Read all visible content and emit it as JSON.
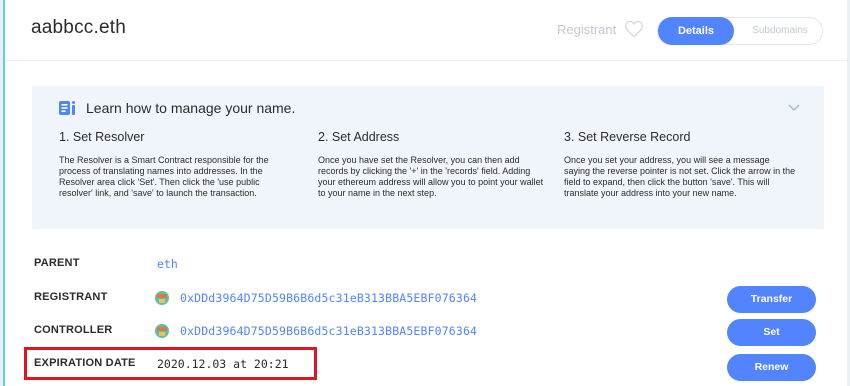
{
  "header": {
    "domain": "aabbcc.eth",
    "registrant_link": "Registrant",
    "tabs": {
      "active": "Details",
      "inactive": "Subdomains"
    }
  },
  "learn": {
    "title": "Learn how to manage your name.",
    "steps": [
      {
        "title": "1. Set Resolver",
        "text": "The Resolver is a Smart Contract responsible for the process of translating names into addresses. In the Resolver area click 'Set'. Then click the 'use public resolver' link, and 'save' to launch the transaction."
      },
      {
        "title": "2. Set Address",
        "text": "Once you have set the Resolver, you can then add records by clicking the '+' in the 'records' field. Adding your ethereum address will allow you to point your wallet to your name in the next step."
      },
      {
        "title": "3. Set Reverse Record",
        "text": "Once you set your address, you will see a message saying the reverse pointer is not set. Click the arrow in the field to expand, then click the button 'save'. This will translate your address into your new name."
      }
    ]
  },
  "details": {
    "parent": {
      "label": "PARENT",
      "value": "eth"
    },
    "registrant": {
      "label": "REGISTRANT",
      "address": "0xDDd3964D75D59B6B6d5c31eB313BBA5EBF076364",
      "button": "Transfer"
    },
    "controller": {
      "label": "CONTROLLER",
      "address": "0xDDd3964D75D59B6B6d5c31eB313BBA5EBF076364",
      "button": "Set"
    },
    "expiration": {
      "label": "EXPIRATION DATE",
      "value": "2020.12.03 at 20:21",
      "button": "Renew"
    }
  },
  "colors": {
    "accent": "#5284ff",
    "highlight": "#e0141e",
    "left_border": "#5ed0ea"
  }
}
